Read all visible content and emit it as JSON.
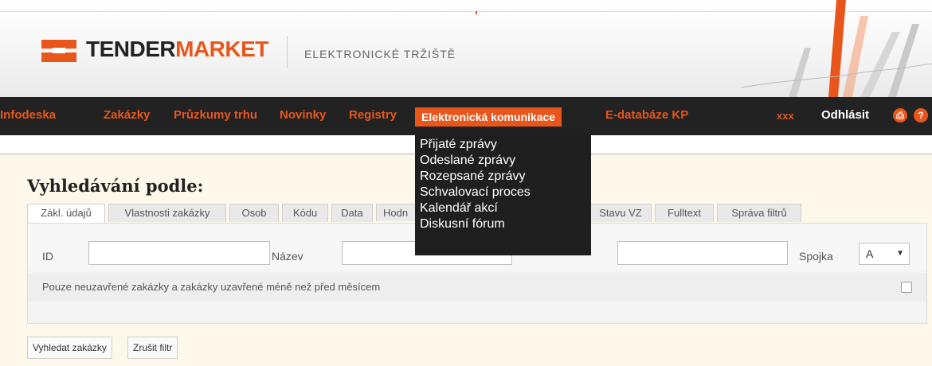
{
  "header": {
    "brand_part1": "TENDER",
    "brand_part2": "MARKET",
    "subtitle": "ELEKTRONICKÉ TRŽIŠTĚ"
  },
  "nav": {
    "items": [
      "Infodeska",
      "Zakázky",
      "Průzkumy trhu",
      "Novinky",
      "Registry"
    ],
    "active": "Elektronická komunikace",
    "extra": "E-databáze KP",
    "user": "xxx",
    "logout": "Odhlásit"
  },
  "dropdown": {
    "items": [
      "Přijaté zprávy",
      "Odeslané zprávy",
      "Rozepsané zprávy",
      "Schvalovací proces",
      "Kalendář akcí",
      "Diskusní fórum"
    ]
  },
  "search": {
    "heading": "Vyhledávání podle:",
    "tabs": [
      "Zákl. údajů",
      "Vlastnosti zakázky",
      "Osob",
      "Kódu",
      "Data",
      "Hodn",
      "Stavu VZ",
      "Fulltext",
      "Správa filtrů"
    ],
    "fields": {
      "id_label": "ID",
      "name_label": "Název",
      "spojka_label": "Spojka",
      "spojka_value": "A"
    },
    "checkbox_label": "Pouze neuzavřené zakázky a zakázky uzavřené méně než před měsícem",
    "search_button": "Vyhledat zakázky",
    "reset_button": "Zrušit filtr"
  },
  "colors": {
    "accent": "#e8561c",
    "nav_bg": "#222222"
  }
}
